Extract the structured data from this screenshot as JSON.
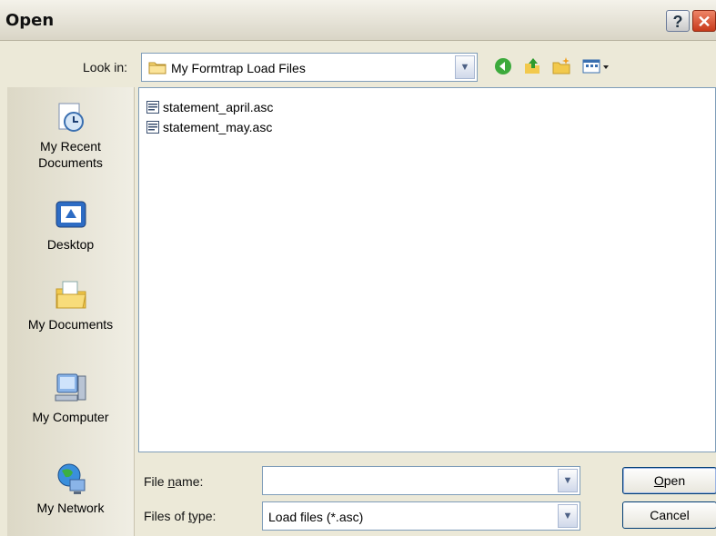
{
  "window": {
    "title": "Open",
    "help_glyph": "?",
    "close_glyph": "✕"
  },
  "look_in": {
    "label": "Look in:",
    "value": "My Formtrap Load Files"
  },
  "toolbar": {
    "icons": [
      "back-icon",
      "up-folder-icon",
      "new-folder-icon",
      "view-menu-icon"
    ]
  },
  "places": [
    {
      "label": "My Recent Documents",
      "icon": "recent-documents-icon"
    },
    {
      "label": "Desktop",
      "icon": "desktop-icon"
    },
    {
      "label": "My Documents",
      "icon": "my-documents-icon"
    },
    {
      "label": "My Computer",
      "icon": "my-computer-icon"
    },
    {
      "label": "My Network",
      "icon": "my-network-icon"
    }
  ],
  "files": [
    {
      "name": "statement_april.asc"
    },
    {
      "name": "statement_may.asc"
    }
  ],
  "file_name": {
    "label_pre": "File ",
    "label_accel": "n",
    "label_post": "ame:",
    "value": ""
  },
  "file_type": {
    "label_pre": "Files of ",
    "label_accel": "t",
    "label_post": "ype:",
    "value": "Load files (*.asc)"
  },
  "buttons": {
    "open_accel": "O",
    "open_rest": "pen",
    "cancel": "Cancel"
  },
  "colors": {
    "dialog_bg": "#ece9d8",
    "border_blue": "#7f9db9",
    "close_red": "#c83a1b"
  }
}
